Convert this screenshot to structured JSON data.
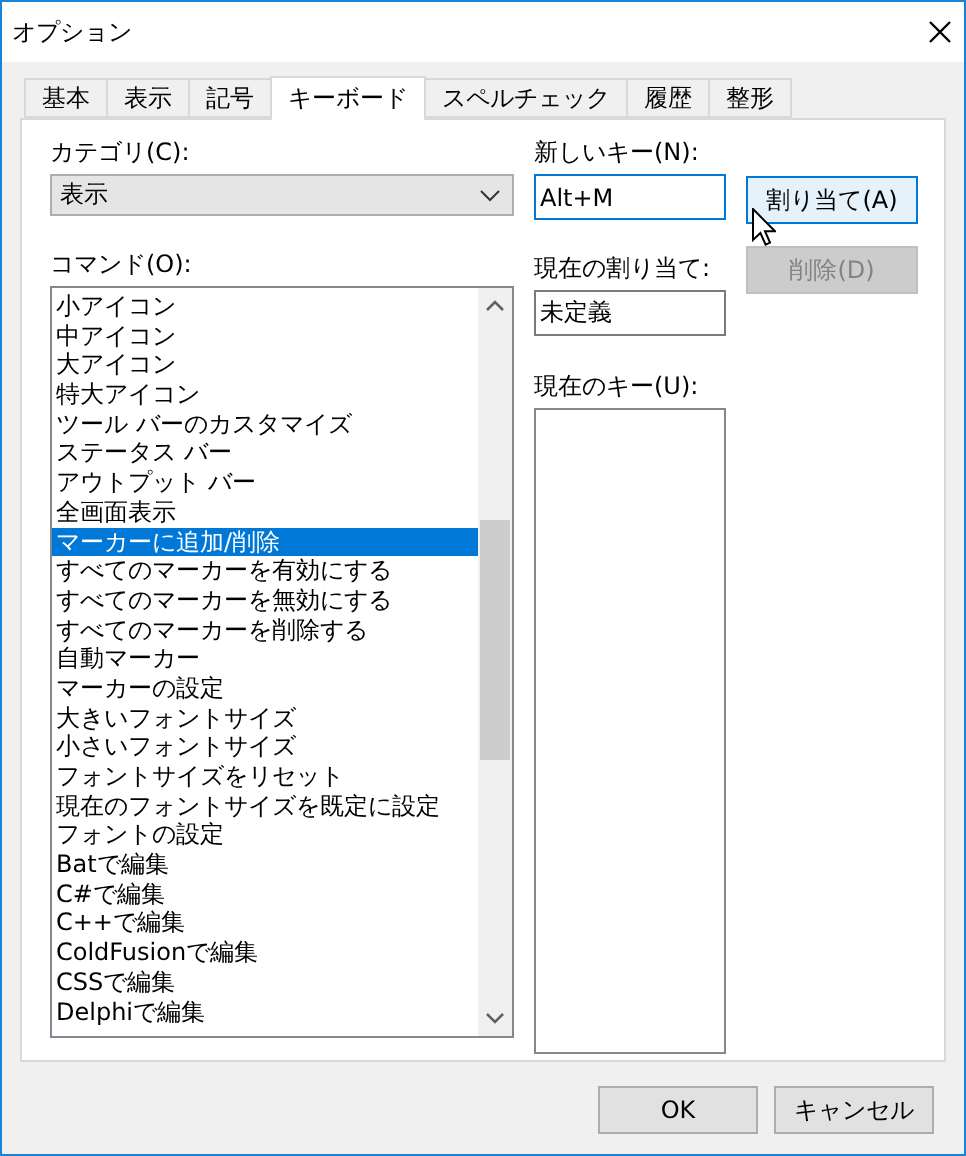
{
  "window": {
    "title": "オプション"
  },
  "tabs": [
    {
      "label": "基本",
      "selected": false
    },
    {
      "label": "表示",
      "selected": false
    },
    {
      "label": "記号",
      "selected": false
    },
    {
      "label": "キーボード",
      "selected": true
    },
    {
      "label": "スペルチェック",
      "selected": false
    },
    {
      "label": "履歴",
      "selected": false
    },
    {
      "label": "整形",
      "selected": false
    }
  ],
  "category": {
    "label": "カテゴリ(C):",
    "value": "表示"
  },
  "commands": {
    "label": "コマンド(O):",
    "items": [
      {
        "text": "小アイコン",
        "selected": false
      },
      {
        "text": "中アイコン",
        "selected": false
      },
      {
        "text": "大アイコン",
        "selected": false
      },
      {
        "text": "特大アイコン",
        "selected": false
      },
      {
        "text": "ツール バーのカスタマイズ",
        "selected": false
      },
      {
        "text": "ステータス バー",
        "selected": false
      },
      {
        "text": "アウトプット バー",
        "selected": false
      },
      {
        "text": "全画面表示",
        "selected": false
      },
      {
        "text": "マーカーに追加/削除",
        "selected": true
      },
      {
        "text": "すべてのマーカーを有効にする",
        "selected": false
      },
      {
        "text": "すべてのマーカーを無効にする",
        "selected": false
      },
      {
        "text": "すべてのマーカーを削除する",
        "selected": false
      },
      {
        "text": "自動マーカー",
        "selected": false
      },
      {
        "text": "マーカーの設定",
        "selected": false
      },
      {
        "text": "大きいフォントサイズ",
        "selected": false
      },
      {
        "text": "小さいフォントサイズ",
        "selected": false
      },
      {
        "text": "フォントサイズをリセット",
        "selected": false
      },
      {
        "text": "現在のフォントサイズを既定に設定",
        "selected": false
      },
      {
        "text": "フォントの設定",
        "selected": false
      },
      {
        "text": "Batで編集",
        "selected": false
      },
      {
        "text": "C#で編集",
        "selected": false
      },
      {
        "text": "C++で編集",
        "selected": false
      },
      {
        "text": "ColdFusionで編集",
        "selected": false
      },
      {
        "text": "CSSで編集",
        "selected": false
      },
      {
        "text": "Delphiで編集",
        "selected": false
      }
    ]
  },
  "new_key": {
    "label": "新しいキー(N):",
    "value": "Alt+M"
  },
  "assign_button": {
    "label": "割り当て(A)",
    "disabled": false
  },
  "delete_button": {
    "label": "削除(D)",
    "disabled": true
  },
  "current_assignment": {
    "label": "現在の割り当て:",
    "value": "未定義"
  },
  "current_keys": {
    "label": "現在のキー(U):"
  },
  "buttons": [
    {
      "label": "OK"
    },
    {
      "label": "キャンセル"
    }
  ]
}
